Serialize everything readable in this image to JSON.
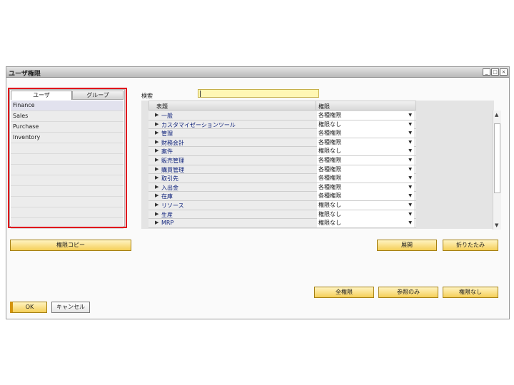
{
  "window": {
    "title": "ユーザ権限",
    "controls": [
      "minimize-icon",
      "restore-icon",
      "close-icon"
    ]
  },
  "left_panel": {
    "tabs": [
      {
        "label": "ユーザ",
        "active": true
      },
      {
        "label": "グループ",
        "active": false
      }
    ],
    "groups": [
      "Finance",
      "Sales",
      "Purchase",
      "Inventory"
    ],
    "empty_rows": 8
  },
  "search": {
    "label": "検索",
    "value": ""
  },
  "permissions": {
    "headers": {
      "subject": "表題",
      "permission": "権限"
    },
    "rows": [
      {
        "subject": "一般",
        "permission": "各種権限"
      },
      {
        "subject": "カスタマイゼーションツール",
        "permission": "権限なし"
      },
      {
        "subject": "管理",
        "permission": "各種権限"
      },
      {
        "subject": "財務会計",
        "permission": "各種権限"
      },
      {
        "subject": "案件",
        "permission": "権限なし"
      },
      {
        "subject": "販売管理",
        "permission": "各種権限"
      },
      {
        "subject": "購買管理",
        "permission": "各種権限"
      },
      {
        "subject": "取引先",
        "permission": "各種権限"
      },
      {
        "subject": "入出金",
        "permission": "各種権限"
      },
      {
        "subject": "在庫",
        "permission": "各種権限"
      },
      {
        "subject": "リソース",
        "permission": "権限なし"
      },
      {
        "subject": "生産",
        "permission": "権限なし"
      },
      {
        "subject": "MRP",
        "permission": "権限なし"
      }
    ]
  },
  "buttons": {
    "copy_permissions": "権限コピー",
    "expand": "展開",
    "collapse": "折りたたみ",
    "full_permission": "全権限",
    "read_only": "参照のみ",
    "no_permission": "権限なし",
    "ok": "OK",
    "cancel": "キャンセル"
  },
  "colors": {
    "button_yellow": "#f5cf58",
    "search_field": "#fff7b4",
    "highlight_red": "#e0001b",
    "subject_text": "#0b1f7a"
  }
}
